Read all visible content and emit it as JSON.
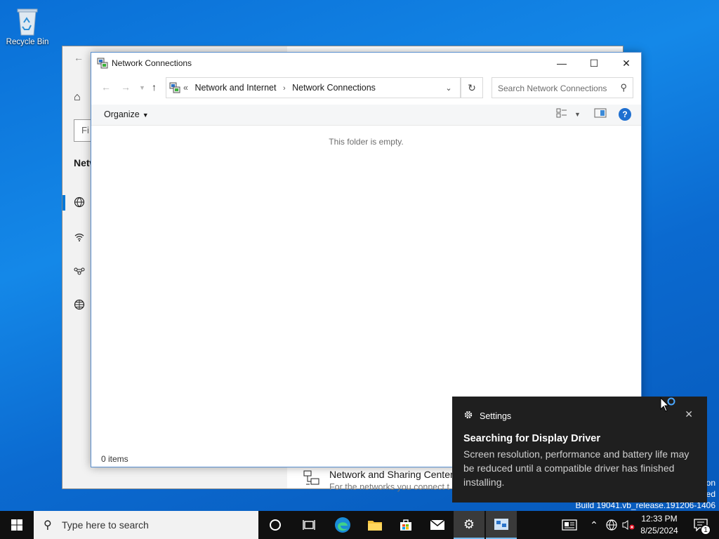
{
  "desktop": {
    "recycle_bin_label": "Recycle Bin"
  },
  "settings_window": {
    "find_placeholder_fragment": "Fi",
    "section_title_fragment": "Netw",
    "network_sharing_center_title": "Network and Sharing Center",
    "network_sharing_center_sub": "For the networks you connect t"
  },
  "explorer": {
    "title": "Network Connections",
    "breadcrumb_overflow": "«",
    "breadcrumbs": [
      "Network and Internet",
      "Network Connections"
    ],
    "search_placeholder": "Search Network Connections",
    "organize_label": "Organize",
    "empty_message": "This folder is empty.",
    "status_items": "0 items"
  },
  "toast": {
    "app_name": "Settings",
    "title": "Searching for Display Driver",
    "body": "Screen resolution, performance and battery life may be reduced until a compatible driver has finished installing."
  },
  "watermark": {
    "line1_fragment": "on",
    "line2_fragment": "ed",
    "build": "Build 19041.vb_release.191206-1406"
  },
  "taskbar": {
    "search_placeholder": "Type here to search",
    "time": "12:33 PM",
    "date": "8/25/2024",
    "notification_count": "1"
  },
  "colors": {
    "accent": "#0078d7",
    "taskbar": "#101010",
    "toast_bg": "#1f1f1f",
    "desktop": "#0a6fd6"
  }
}
